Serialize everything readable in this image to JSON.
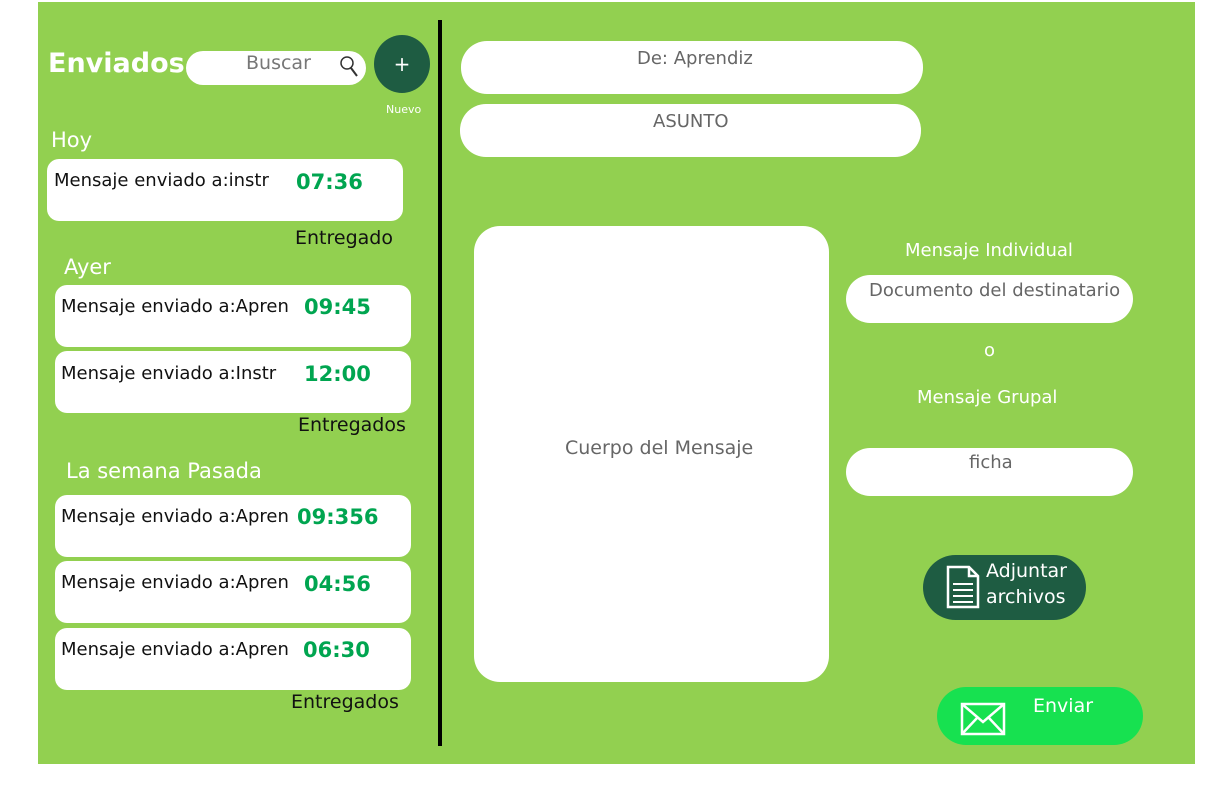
{
  "sidebar": {
    "title": "Enviados",
    "search_placeholder": "Buscar",
    "new_button_symbol": "+",
    "new_button_label": "Nuevo",
    "groups": [
      {
        "label": "Hoy",
        "messages": [
          {
            "text": "Mensaje enviado a:instr",
            "time": "07:36"
          }
        ],
        "status": "Entregado"
      },
      {
        "label": "Ayer",
        "messages": [
          {
            "text": "Mensaje enviado a:Apren",
            "time": "09:45"
          },
          {
            "text": "Mensaje enviado a:Instr",
            "time": "12:00"
          }
        ],
        "status": "Entregados"
      },
      {
        "label": "La semana Pasada",
        "messages": [
          {
            "text": "Mensaje enviado a:Apren",
            "time": "09:356"
          },
          {
            "text": "Mensaje enviado a:Apren",
            "time": "04:56"
          },
          {
            "text": "Mensaje enviado a:Apren",
            "time": "06:30"
          }
        ],
        "status": "Entregados"
      }
    ]
  },
  "compose": {
    "from": "De: Aprendiz",
    "subject": "ASUNTO",
    "body": "Cuerpo del Mensaje",
    "individual_label": "Mensaje Individual",
    "recipient_doc": "Documento del destinatario",
    "or_label": "o",
    "group_label": "Mensaje Grupal",
    "ficha": "ficha",
    "attach_label_line1": "Adjuntar",
    "attach_label_line2": "archivos",
    "send_label": "Enviar"
  },
  "colors": {
    "background": "#92d050",
    "dark_green": "#1e5c42",
    "time_green": "#00a550",
    "send_green": "#17e150"
  },
  "icons": {
    "search": "search-icon",
    "attach": "document-icon",
    "send": "envelope-icon"
  }
}
